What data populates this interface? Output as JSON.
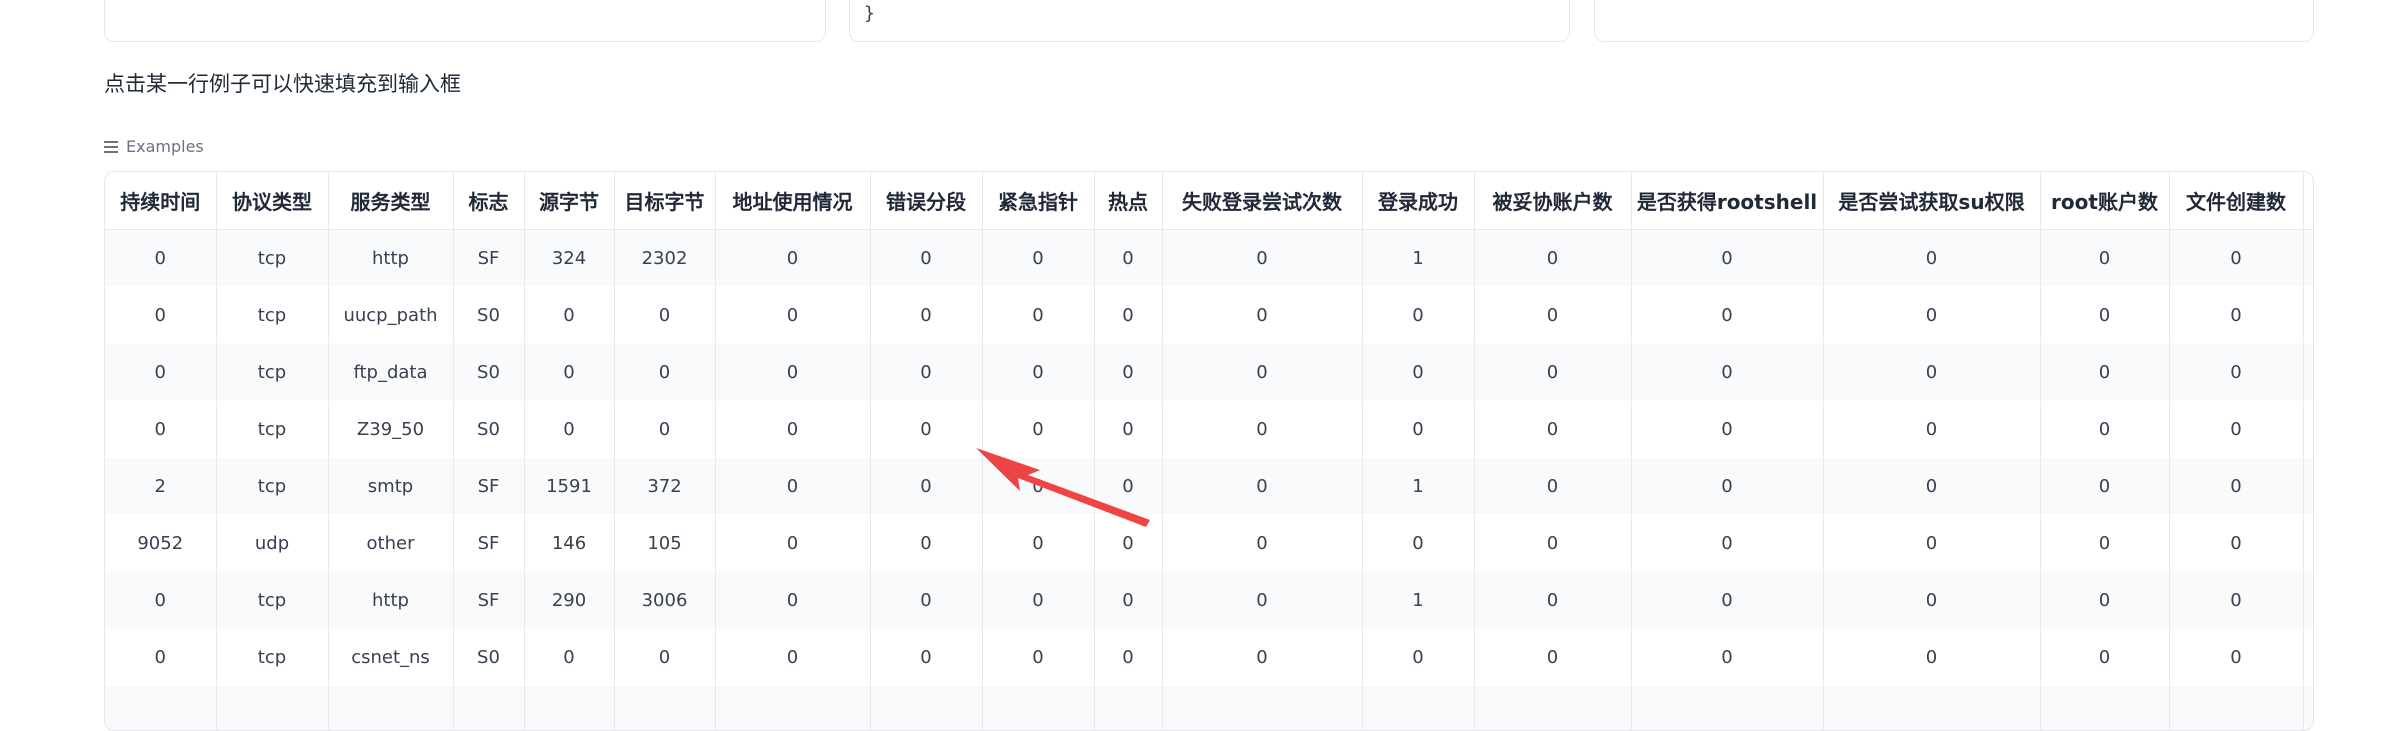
{
  "top_boxes": {
    "middle_text": "}"
  },
  "hint_text": "点击某一行例子可以快速填充到输入框",
  "examples_label": "Examples",
  "table": {
    "columns": [
      "持续时间",
      "协议类型",
      "服务类型",
      "标志",
      "源字节",
      "目标字节",
      "地址使用情况",
      "错误分段",
      "紧急指针",
      "热点",
      "失败登录尝试次数",
      "登录成功",
      "被妥协账户数",
      "是否获得rootshell",
      "是否尝试获取su权限",
      "root账户数",
      "文件创建数",
      ""
    ],
    "rows": [
      [
        "0",
        "tcp",
        "http",
        "SF",
        "324",
        "2302",
        "0",
        "0",
        "0",
        "0",
        "0",
        "1",
        "0",
        "0",
        "0",
        "0",
        "0",
        ""
      ],
      [
        "0",
        "tcp",
        "uucp_path",
        "S0",
        "0",
        "0",
        "0",
        "0",
        "0",
        "0",
        "0",
        "0",
        "0",
        "0",
        "0",
        "0",
        "0",
        ""
      ],
      [
        "0",
        "tcp",
        "ftp_data",
        "S0",
        "0",
        "0",
        "0",
        "0",
        "0",
        "0",
        "0",
        "0",
        "0",
        "0",
        "0",
        "0",
        "0",
        ""
      ],
      [
        "0",
        "tcp",
        "Z39_50",
        "S0",
        "0",
        "0",
        "0",
        "0",
        "0",
        "0",
        "0",
        "0",
        "0",
        "0",
        "0",
        "0",
        "0",
        ""
      ],
      [
        "2",
        "tcp",
        "smtp",
        "SF",
        "1591",
        "372",
        "0",
        "0",
        "0",
        "0",
        "0",
        "1",
        "0",
        "0",
        "0",
        "0",
        "0",
        ""
      ],
      [
        "9052",
        "udp",
        "other",
        "SF",
        "146",
        "105",
        "0",
        "0",
        "0",
        "0",
        "0",
        "0",
        "0",
        "0",
        "0",
        "0",
        "0",
        ""
      ],
      [
        "0",
        "tcp",
        "http",
        "SF",
        "290",
        "3006",
        "0",
        "0",
        "0",
        "0",
        "0",
        "1",
        "0",
        "0",
        "0",
        "0",
        "0",
        ""
      ],
      [
        "0",
        "tcp",
        "csnet_ns",
        "S0",
        "0",
        "0",
        "0",
        "0",
        "0",
        "0",
        "0",
        "0",
        "0",
        "0",
        "0",
        "0",
        "0",
        ""
      ],
      [
        "",
        "",
        "",
        "",
        "",
        "",
        "",
        "",
        "",
        "",
        "",
        "",
        "",
        "",
        "",
        "",
        "",
        ""
      ]
    ]
  },
  "colors": {
    "arrow": "#ef4444",
    "border": "#e5e7eb",
    "stripe": "#f9fafb"
  },
  "icons": {
    "examples": "list-icon",
    "annotation": "red-arrow-icon"
  }
}
